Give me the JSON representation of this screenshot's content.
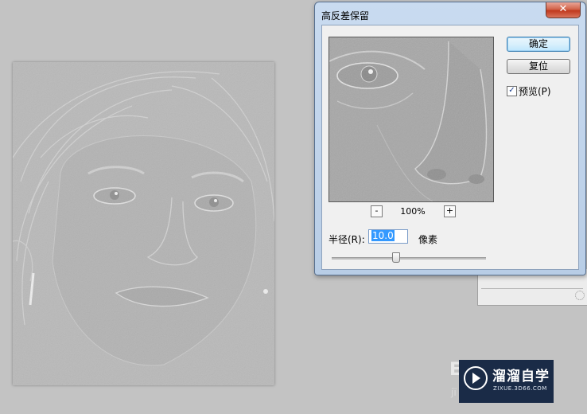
{
  "dialog": {
    "title": "高反差保留",
    "close_label": "✕",
    "ok_label": "确定",
    "reset_label": "复位",
    "preview_checked": true,
    "preview_label": "预览(P)",
    "zoom_out_label": "-",
    "zoom_in_label": "+",
    "zoom_level": "100%",
    "radius_label": "半径(R):",
    "radius_value": "10.0",
    "radius_unit": "像素",
    "slider_fraction": 0.41
  },
  "watermark": {
    "title": "溜溜自学",
    "subtitle": "ZIXUE.3D66.COM"
  },
  "colors": {
    "canvas_bg": "#c3c3c3",
    "dialog_frame": "#b8cde6",
    "close_button": "#c0391e",
    "selection": "#3399ff",
    "watermark_bg": "#1a2b47"
  },
  "icons": {
    "close": "close-icon",
    "checkbox": "check-icon",
    "logo": "play-logo-icon"
  }
}
